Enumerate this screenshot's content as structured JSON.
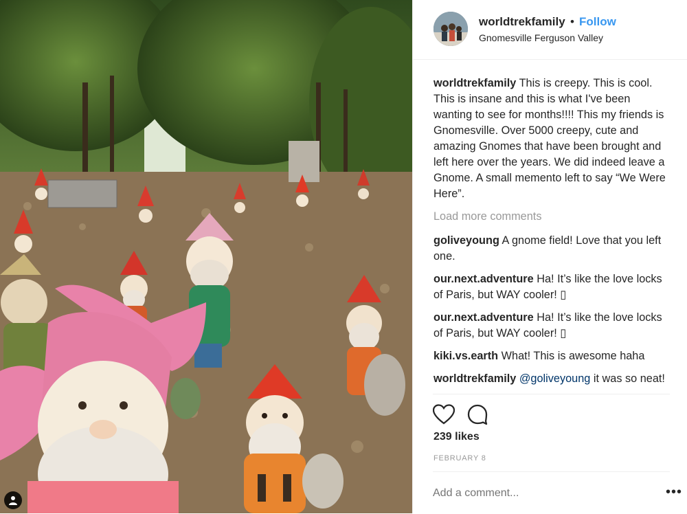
{
  "post": {
    "username": "worldtrekfamily",
    "separator": "•",
    "follow_label": "Follow",
    "location": "Gnomesville Ferguson Valley",
    "caption_user": "worldtrekfamily",
    "caption_text": "This is creepy. This is cool. This is insane and this is what I've been wanting to see for months!!!! This my friends is Gnomesville. Over 5000 creepy, cute and amazing Gnomes that have been brought and left here over the years. We did indeed leave a Gnome. A small memento left to say “We Were Here”.",
    "load_more": "Load more comments",
    "comments": [
      {
        "user": "goliveyoung",
        "text": "A gnome field! Love that you left one."
      },
      {
        "user": "our.next.adventure",
        "text": "Ha! It’s like the love locks of Paris, but WAY cooler! ▯"
      },
      {
        "user": "our.next.adventure",
        "text": "Ha! It’s like the love locks of Paris, but WAY cooler! ▯"
      },
      {
        "user": "kiki.vs.earth",
        "text": "What! This is awesome haha"
      }
    ],
    "reply": {
      "user": "worldtrekfamily",
      "mention": "@goliveyoung",
      "text": "it was so neat!"
    },
    "likes": "239 likes",
    "date": "FEBRUARY 8",
    "add_comment_placeholder": "Add a comment...",
    "more_label": "•••"
  },
  "icons": {
    "like": "heart-icon",
    "comment": "speech-bubble-icon",
    "user_tag": "person-icon",
    "options": "ellipsis-icon"
  },
  "colors": {
    "link": "#3897f0",
    "text": "#262626",
    "muted": "#999999",
    "mention": "#003569"
  }
}
